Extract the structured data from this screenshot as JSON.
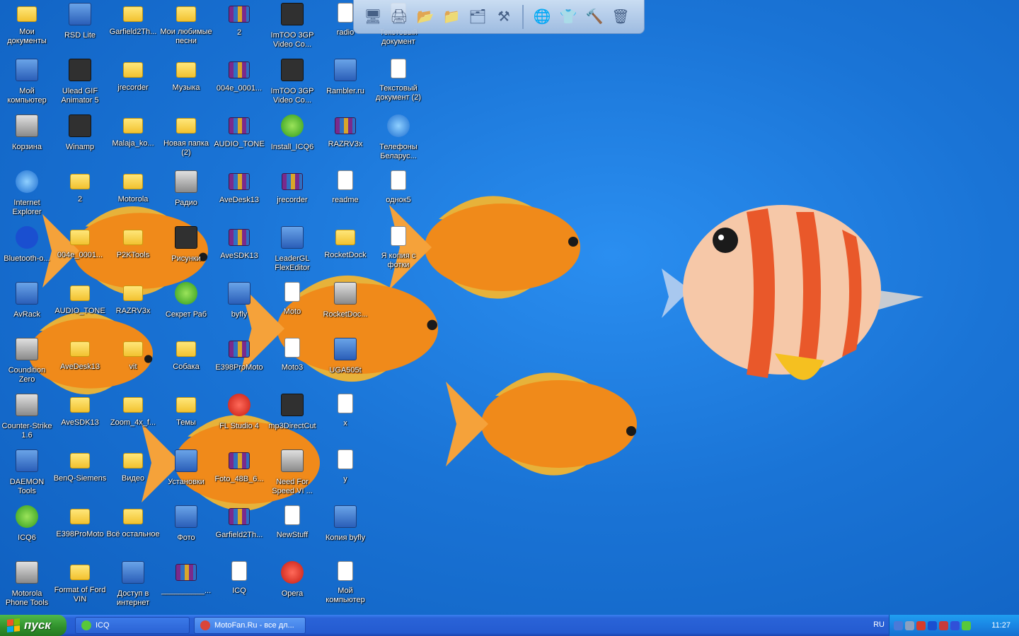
{
  "desktop": {
    "icons": [
      {
        "label": "Мои документы",
        "icon": "my-documents-icon",
        "glyph": "g-folder",
        "col": 0,
        "row": 0
      },
      {
        "label": "Мой компьютер",
        "icon": "my-computer-icon",
        "glyph": "g-app",
        "col": 0,
        "row": 1
      },
      {
        "label": "Корзина",
        "icon": "recycle-bin-icon",
        "glyph": "g-gray",
        "col": 0,
        "row": 2
      },
      {
        "label": "Internet Explorer",
        "icon": "internet-explorer-icon",
        "glyph": "g-ie",
        "col": 0,
        "row": 3
      },
      {
        "label": "Bluetooth-о...",
        "icon": "bluetooth-icon",
        "glyph": "g-bt",
        "col": 0,
        "row": 4
      },
      {
        "label": "AvRack",
        "icon": "avrack-icon",
        "glyph": "g-app",
        "col": 0,
        "row": 5
      },
      {
        "label": "Coundition Zero",
        "icon": "counter-strike-icon",
        "glyph": "g-gray",
        "col": 0,
        "row": 6
      },
      {
        "label": "Counter-Strike 1.6",
        "icon": "counter-strike-icon",
        "glyph": "g-gray",
        "col": 0,
        "row": 7
      },
      {
        "label": "DAEMON Tools",
        "icon": "daemon-tools-icon",
        "glyph": "g-app",
        "col": 0,
        "row": 8
      },
      {
        "label": "ICQ6",
        "icon": "icq-flower-icon",
        "glyph": "g-green",
        "col": 0,
        "row": 9
      },
      {
        "label": "Motorola Phone Tools",
        "icon": "motorola-phone-tools-icon",
        "glyph": "g-gray",
        "col": 0,
        "row": 10
      },
      {
        "label": "RSD Lite",
        "icon": "motorola-logo-icon",
        "glyph": "g-app",
        "col": 1,
        "row": 0
      },
      {
        "label": "Ulead GIF Animator 5",
        "icon": "ulead-gif-icon",
        "glyph": "g-dark",
        "col": 1,
        "row": 1
      },
      {
        "label": "Winamp",
        "icon": "winamp-icon",
        "glyph": "g-dark",
        "col": 1,
        "row": 2
      },
      {
        "label": "2",
        "icon": "folder-icon",
        "glyph": "g-folder",
        "col": 1,
        "row": 3
      },
      {
        "label": "004e_0001...",
        "icon": "folder-icon",
        "glyph": "g-folder",
        "col": 1,
        "row": 4
      },
      {
        "label": "AUDIO_TONE",
        "icon": "folder-icon",
        "glyph": "g-folder",
        "col": 1,
        "row": 5
      },
      {
        "label": "AveDesk13",
        "icon": "folder-icon",
        "glyph": "g-folder",
        "col": 1,
        "row": 6
      },
      {
        "label": "AveSDK13",
        "icon": "folder-icon",
        "glyph": "g-folder",
        "col": 1,
        "row": 7
      },
      {
        "label": "BenQ-Siemens",
        "icon": "folder-icon",
        "glyph": "g-folder",
        "col": 1,
        "row": 8
      },
      {
        "label": "E398ProMoto",
        "icon": "folder-icon",
        "glyph": "g-folder",
        "col": 1,
        "row": 9
      },
      {
        "label": "Format of Ford VIN",
        "icon": "folder-icon",
        "glyph": "g-folder",
        "col": 1,
        "row": 10
      },
      {
        "label": "Garfield2Th...",
        "icon": "folder-icon",
        "glyph": "g-folder",
        "col": 2,
        "row": 0
      },
      {
        "label": "jrecorder",
        "icon": "folder-icon",
        "glyph": "g-folder",
        "col": 2,
        "row": 1
      },
      {
        "label": "Malaja_ko...",
        "icon": "folder-icon",
        "glyph": "g-folder",
        "col": 2,
        "row": 2
      },
      {
        "label": "Motorola",
        "icon": "folder-icon",
        "glyph": "g-folder",
        "col": 2,
        "row": 3
      },
      {
        "label": "P2KTools",
        "icon": "folder-icon",
        "glyph": "g-folder",
        "col": 2,
        "row": 4
      },
      {
        "label": "RAZRV3x",
        "icon": "folder-icon",
        "glyph": "g-folder",
        "col": 2,
        "row": 5
      },
      {
        "label": "vit",
        "icon": "folder-icon",
        "glyph": "g-folder",
        "col": 2,
        "row": 6
      },
      {
        "label": "Zoom_4x_f...",
        "icon": "folder-icon",
        "glyph": "g-folder",
        "col": 2,
        "row": 7
      },
      {
        "label": "Видео",
        "icon": "folder-icon",
        "glyph": "g-folder",
        "col": 2,
        "row": 8
      },
      {
        "label": "Всё остальное",
        "icon": "folder-icon",
        "glyph": "g-folder",
        "col": 2,
        "row": 9
      },
      {
        "label": "Доступ в интернет",
        "icon": "windows-flag-icon",
        "glyph": "g-app",
        "col": 2,
        "row": 10
      },
      {
        "label": "Мои любимые песни",
        "icon": "folder-icon",
        "glyph": "g-folder",
        "col": 3,
        "row": 0
      },
      {
        "label": "Музыка",
        "icon": "music-folder-icon",
        "glyph": "g-folder",
        "col": 3,
        "row": 1
      },
      {
        "label": "Новая папка (2)",
        "icon": "folder-icon",
        "glyph": "g-folder",
        "col": 3,
        "row": 2
      },
      {
        "label": "Радио",
        "icon": "phone-icon",
        "glyph": "g-gray",
        "col": 3,
        "row": 3
      },
      {
        "label": "Рисунки",
        "icon": "pictures-icon",
        "glyph": "g-dark",
        "col": 3,
        "row": 4
      },
      {
        "label": "Секрет Раб",
        "icon": "tree-icon",
        "glyph": "g-green",
        "col": 3,
        "row": 5
      },
      {
        "label": "Собака",
        "icon": "folder-icon",
        "glyph": "g-folder",
        "col": 3,
        "row": 6
      },
      {
        "label": "Темы",
        "icon": "folder-icon",
        "glyph": "g-folder",
        "col": 3,
        "row": 7
      },
      {
        "label": "Установки",
        "icon": "setup-icon",
        "glyph": "g-app",
        "col": 3,
        "row": 8
      },
      {
        "label": "Фото",
        "icon": "photo-people-icon",
        "glyph": "g-app",
        "col": 3,
        "row": 9
      },
      {
        "label": "__________...",
        "icon": "rar-archive-icon",
        "glyph": "g-rar",
        "col": 3,
        "row": 10
      },
      {
        "label": "2",
        "icon": "rar-archive-icon",
        "glyph": "g-rar",
        "col": 4,
        "row": 0
      },
      {
        "label": "004e_0001...",
        "icon": "rar-archive-icon",
        "glyph": "g-rar",
        "col": 4,
        "row": 1
      },
      {
        "label": "AUDIO_TONE",
        "icon": "rar-archive-icon",
        "glyph": "g-rar",
        "col": 4,
        "row": 2
      },
      {
        "label": "AveDesk13",
        "icon": "rar-archive-icon",
        "glyph": "g-rar",
        "col": 4,
        "row": 3
      },
      {
        "label": "AveSDK13",
        "icon": "rar-archive-icon",
        "glyph": "g-rar",
        "col": 4,
        "row": 4
      },
      {
        "label": "byfly",
        "icon": "network-icon",
        "glyph": "g-app",
        "col": 4,
        "row": 5
      },
      {
        "label": "E398ProMoto",
        "icon": "rar-archive-icon",
        "glyph": "g-rar",
        "col": 4,
        "row": 6
      },
      {
        "label": "FL Studio 4",
        "icon": "fl-studio-icon",
        "glyph": "g-red",
        "col": 4,
        "row": 7
      },
      {
        "label": "Foto_48B_6...",
        "icon": "rar-archive-icon",
        "glyph": "g-rar",
        "col": 4,
        "row": 8
      },
      {
        "label": "Garfield2Th...",
        "icon": "rar-archive-icon",
        "glyph": "g-rar",
        "col": 4,
        "row": 9
      },
      {
        "label": "ICQ",
        "icon": "text-document-icon",
        "glyph": "g-doc",
        "col": 4,
        "row": 10
      },
      {
        "label": "ImTOO 3GP Video Co...",
        "icon": "imtoo-phone-icon",
        "glyph": "g-dark",
        "col": 5,
        "row": 0
      },
      {
        "label": "ImTOO 3GP Video Co...",
        "icon": "imtoo-phone-icon",
        "glyph": "g-dark",
        "col": 5,
        "row": 1
      },
      {
        "label": "Install_ICQ6",
        "icon": "icq-flower-icon",
        "glyph": "g-green",
        "col": 5,
        "row": 2
      },
      {
        "label": "jrecorder",
        "icon": "rar-archive-icon",
        "glyph": "g-rar",
        "col": 5,
        "row": 3
      },
      {
        "label": "LeaderGL FlexEditor",
        "icon": "flexeditor-icon",
        "glyph": "g-app",
        "col": 5,
        "row": 4
      },
      {
        "label": "Moto",
        "icon": "file-icon",
        "glyph": "g-doc",
        "col": 5,
        "row": 5
      },
      {
        "label": "Moto3",
        "icon": "file-icon",
        "glyph": "g-doc",
        "col": 5,
        "row": 6
      },
      {
        "label": "mp3DirectCut",
        "icon": "mp3directcut-icon",
        "glyph": "g-dark",
        "col": 5,
        "row": 7
      },
      {
        "label": "Need For Speed VI ...",
        "icon": "need-for-speed-icon",
        "glyph": "g-gray",
        "col": 5,
        "row": 8
      },
      {
        "label": "NewStuff",
        "icon": "file-icon",
        "glyph": "g-doc",
        "col": 5,
        "row": 9
      },
      {
        "label": "Opera",
        "icon": "opera-icon",
        "glyph": "g-red",
        "col": 5,
        "row": 10
      },
      {
        "label": "radio",
        "icon": "file-icon",
        "glyph": "g-doc",
        "col": 6,
        "row": 0
      },
      {
        "label": "Rambler.ru",
        "icon": "network-computer-icon",
        "glyph": "g-app",
        "col": 6,
        "row": 1
      },
      {
        "label": "RAZRV3x",
        "icon": "rar-archive-icon",
        "glyph": "g-rar",
        "col": 6,
        "row": 2
      },
      {
        "label": "readme",
        "icon": "text-document-icon",
        "glyph": "g-doc",
        "col": 6,
        "row": 3
      },
      {
        "label": "RocketDock",
        "icon": "rocketdock-icon",
        "glyph": "g-folder",
        "col": 6,
        "row": 4
      },
      {
        "label": "RocketDoc...",
        "icon": "cd-icon",
        "glyph": "g-gray",
        "col": 6,
        "row": 5
      },
      {
        "label": "UGA505t",
        "icon": "uga-icon",
        "glyph": "g-app",
        "col": 6,
        "row": 6
      },
      {
        "label": "x",
        "icon": "file-icon",
        "glyph": "g-doc",
        "col": 6,
        "row": 7
      },
      {
        "label": "y",
        "icon": "file-icon",
        "glyph": "g-doc",
        "col": 6,
        "row": 8
      },
      {
        "label": "Копия byfly",
        "icon": "network-icon",
        "glyph": "g-app",
        "col": 6,
        "row": 9
      },
      {
        "label": "Мой компьютер",
        "icon": "desklet-icon",
        "glyph": "g-doc",
        "col": 6,
        "row": 10
      },
      {
        "label": "Текстовый документ",
        "icon": "text-document-icon",
        "glyph": "g-doc",
        "col": 7,
        "row": 0
      },
      {
        "label": "Текстовый документ (2)",
        "icon": "text-document-icon",
        "glyph": "g-doc",
        "col": 7,
        "row": 1
      },
      {
        "label": "Телефоны Беларус...",
        "icon": "globe-people-icon",
        "glyph": "g-ie",
        "col": 7,
        "row": 2
      },
      {
        "label": "однок5",
        "icon": "image-file-icon",
        "glyph": "g-doc",
        "col": 7,
        "row": 3
      },
      {
        "label": "Я копия с фотки",
        "icon": "image-file-icon",
        "glyph": "g-doc",
        "col": 7,
        "row": 4
      }
    ]
  },
  "toolbar": {
    "buttons": [
      {
        "icon": "computer-icon",
        "glyph": "🖥"
      },
      {
        "icon": "printer-icon",
        "glyph": "🖨"
      },
      {
        "icon": "open-folder-icon",
        "glyph": "📂"
      },
      {
        "icon": "folder-icon",
        "glyph": "📁"
      },
      {
        "icon": "picture-folder-icon",
        "glyph": "🗂"
      },
      {
        "icon": "tools-icon",
        "glyph": "⚒"
      },
      {
        "sep": true
      },
      {
        "icon": "globe-network-icon",
        "glyph": "🌐"
      },
      {
        "icon": "tshirt-icon",
        "glyph": "👕"
      },
      {
        "icon": "hammer-icon",
        "glyph": "🔨"
      },
      {
        "icon": "recycle-bin-icon",
        "glyph": "🗑"
      }
    ]
  },
  "taskbar": {
    "start_label": "пуск",
    "tasks": [
      {
        "label": "ICQ",
        "icon": "icq-flower-icon",
        "color": "#58c83a"
      },
      {
        "label": "MotoFan.Ru - все дл...",
        "icon": "browser-icon",
        "color": "#d9453a"
      }
    ],
    "language": "RU",
    "clock": "11:27",
    "tray_icons": [
      "show-hidden-icon",
      "network-icon",
      "flag-icon",
      "bluetooth-icon",
      "shield-icon",
      "bluetooth-2-icon",
      "icq-flower-icon"
    ]
  },
  "colors": {
    "desktop_bg": "#1a74d6",
    "taskbar_bg": "#245bd0",
    "start_green": "#2f8f2b",
    "tray_bg": "#1a86e4"
  }
}
